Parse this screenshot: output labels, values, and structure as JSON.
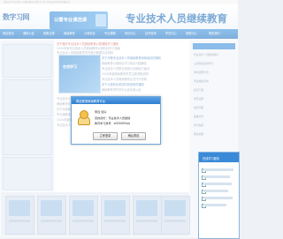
{
  "topbar": {
    "notice": "欢迎访问专业技术人员继续教育在线学习平台 本站支持多种浏览器访问"
  },
  "header": {
    "logo_text": "数字习网",
    "promo_label": "公需专业课选课",
    "site_title": "专业技术人员继续教育"
  },
  "nav": {
    "items": [
      "网站首页",
      "通知公告",
      "政策法规",
      "继续教育",
      "公需科目",
      "专业课程",
      "考试中心",
      "证书查询",
      "学员中心",
      "帮助中心",
      "联系我们"
    ]
  },
  "main": {
    "news": [
      {
        "text": "关于做好专业技术人员继续教育公需课程学习通知",
        "style": "hl"
      },
      {
        "text": "2020年度专业技术人员继续教育公需科目学习指南",
        "style": "normal"
      },
      {
        "text": "专业技术人员继续教育学时登记管理办法说明",
        "style": "normal"
      },
      {
        "text": "关于开展专业技术人员继续教育网络培训的通知",
        "style": "blue"
      },
      {
        "text": "继续教育公需科目学习常见问题解答",
        "style": "normal"
      },
      {
        "text": "专业技术人员职业道德与创新能力建设",
        "style": "normal"
      },
      {
        "text": "2020年度继续教育学员注册流程说明",
        "style": "normal"
      },
      {
        "text": "专业技术人员继续教育证书打印说明",
        "style": "normal"
      },
      {
        "text": "关于公需科目考试时间安排的通知",
        "style": "blue"
      },
      {
        "text": "继续教育学时学分认定标准公告",
        "style": "normal"
      },
      {
        "text": "专业技术人员信息化能力提升课程",
        "style": "normal"
      },
      {
        "text": "继续教育在线学习平台使用手册",
        "style": "normal"
      },
      {
        "text": "关于加强继续教育学习管理的通知",
        "style": "normal"
      },
      {
        "text": "专业课程选课及缴费流程说明",
        "style": "normal"
      },
      {
        "text": "2020年度继续教育考核结果公示",
        "style": "normal"
      },
      {
        "text": "专业技术人员继续教育条例解读",
        "style": "normal"
      }
    ],
    "promo_image_label": "在线学习"
  },
  "right_panel": {
    "title": "热门推荐",
    "links": [
      "专业技术人员继续教育",
      "公需科目在线学习",
      "学时证明打印",
      "考试成绩查询",
      "证书下载",
      "学员注册",
      "常见问题",
      "政策文件",
      "学习指南",
      "联系客服"
    ]
  },
  "dialog": {
    "title": "欢迎登录继续教育平台",
    "close_label": "×",
    "greeting": "李四 您好",
    "line1": "您的身份：专业技术人员继续",
    "line2": "教育学习账号：e0000954ej",
    "confirm_label": "立即登录",
    "cancel_label": "稍后再说"
  },
  "side_popup": {
    "title": "在线学习服务"
  },
  "colors": {
    "brand_blue": "#1265b5",
    "nav_blue": "#2f8ddc",
    "dialog_border": "#6ea6da"
  }
}
